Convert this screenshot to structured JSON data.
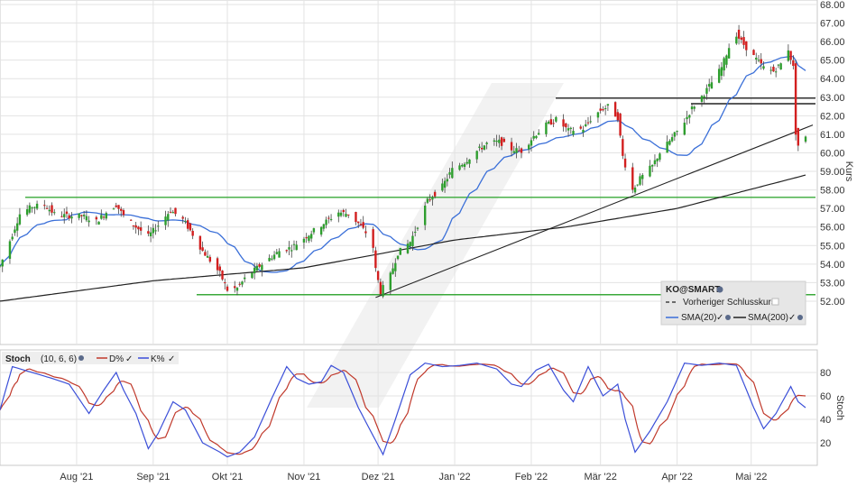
{
  "chart_data": [
    {
      "type": "candlestick",
      "symbol": "KO@SMART",
      "ylabel": "Kurs",
      "ylim": [
        51.0,
        68.0
      ],
      "y_ticks": [
        "68.00",
        "67.00",
        "66.00",
        "65.00",
        "64.00",
        "63.00",
        "62.00",
        "61.00",
        "60.00",
        "59.00",
        "58.00",
        "57.00",
        "56.00",
        "55.00",
        "54.00",
        "53.00",
        "52.00"
      ],
      "x_labels": [
        "Aug '21",
        "Sep '21",
        "Okt '21",
        "Nov '21",
        "Dez '21",
        "Jan '22",
        "Feb '22",
        "Mär '22",
        "Apr '22",
        "Mai '22"
      ],
      "legend": {
        "title": "KO@SMART",
        "items": [
          "Vorheriger Schlusskurs",
          "SMA(20)",
          "SMA(200)"
        ]
      },
      "colors": {
        "up": "#2e9e2e",
        "down": "#d21f1f",
        "sma20": "#3a6fd8",
        "sma200": "#222222",
        "support": "#3aa93a",
        "resistance": "#222222"
      },
      "horizontal_levels": [
        {
          "name": "green-support-57.6",
          "y": 57.6,
          "color": "#3aa93a"
        },
        {
          "name": "green-support-52.35",
          "y": 52.35,
          "color": "#3aa93a"
        },
        {
          "name": "resistance-62.95",
          "y": 62.95,
          "color": "#222222"
        },
        {
          "name": "resistance-62.65",
          "y": 62.65,
          "color": "#222222"
        }
      ],
      "trendline": {
        "from": [
          "2021-11-30",
          52.2
        ],
        "to": [
          "2022-05-23",
          61.5
        ]
      },
      "anchors": [
        [
          "2021-07-01",
          53.9
        ],
        [
          "2021-07-06",
          55.6
        ],
        [
          "2021-07-09",
          56.7
        ],
        [
          "2021-07-14",
          57.1
        ],
        [
          "2021-07-19",
          57.2
        ],
        [
          "2021-07-23",
          56.7
        ],
        [
          "2021-07-28",
          56.6
        ],
        [
          "2021-08-03",
          56.6
        ],
        [
          "2021-08-09",
          56.3
        ],
        [
          "2021-08-13",
          56.8
        ],
        [
          "2021-08-17",
          57.2
        ],
        [
          "2021-08-20",
          56.6
        ],
        [
          "2021-08-25",
          56.0
        ],
        [
          "2021-08-30",
          55.5
        ],
        [
          "2021-09-03",
          56.1
        ],
        [
          "2021-09-08",
          56.9
        ],
        [
          "2021-09-13",
          56.4
        ],
        [
          "2021-09-17",
          55.6
        ],
        [
          "2021-09-21",
          54.7
        ],
        [
          "2021-09-24",
          54.2
        ],
        [
          "2021-09-28",
          53.5
        ],
        [
          "2021-10-01",
          52.6
        ],
        [
          "2021-10-05",
          52.7
        ],
        [
          "2021-10-08",
          53.2
        ],
        [
          "2021-10-13",
          53.8
        ],
        [
          "2021-10-18",
          54.3
        ],
        [
          "2021-10-22",
          54.7
        ],
        [
          "2021-10-27",
          54.9
        ],
        [
          "2021-11-01",
          55.4
        ],
        [
          "2021-11-05",
          55.8
        ],
        [
          "2021-11-10",
          56.3
        ],
        [
          "2021-11-15",
          56.8
        ],
        [
          "2021-11-19",
          56.7
        ],
        [
          "2021-11-23",
          56.2
        ],
        [
          "2021-11-26",
          55.7
        ],
        [
          "2021-11-29",
          54.9
        ],
        [
          "2021-11-30",
          53.7
        ],
        [
          "2021-12-02",
          52.5
        ],
        [
          "2021-12-06",
          53.4
        ],
        [
          "2021-12-09",
          54.6
        ],
        [
          "2021-12-14",
          55.2
        ],
        [
          "2021-12-17",
          56.1
        ],
        [
          "2021-12-21",
          57.4
        ],
        [
          "2021-12-27",
          58.2
        ],
        [
          "2021-12-31",
          59.1
        ],
        [
          "2022-01-05",
          59.5
        ],
        [
          "2022-01-10",
          60.1
        ],
        [
          "2022-01-14",
          60.5
        ],
        [
          "2022-01-19",
          60.6
        ],
        [
          "2022-01-24",
          60.2
        ],
        [
          "2022-01-28",
          60.1
        ],
        [
          "2022-02-02",
          60.9
        ],
        [
          "2022-02-07",
          61.5
        ],
        [
          "2022-02-11",
          61.8
        ],
        [
          "2022-02-16",
          61.2
        ],
        [
          "2022-02-22",
          61.3
        ],
        [
          "2022-02-25",
          61.8
        ],
        [
          "2022-03-01",
          62.3
        ],
        [
          "2022-03-04",
          62.5
        ],
        [
          "2022-03-08",
          61.9
        ],
        [
          "2022-03-10",
          59.8
        ],
        [
          "2022-03-14",
          58.0
        ],
        [
          "2022-03-17",
          58.6
        ],
        [
          "2022-03-22",
          59.3
        ],
        [
          "2022-03-25",
          60.0
        ],
        [
          "2022-03-30",
          60.8
        ],
        [
          "2022-04-04",
          61.7
        ],
        [
          "2022-04-07",
          62.4
        ],
        [
          "2022-04-12",
          63.2
        ],
        [
          "2022-04-14",
          63.6
        ],
        [
          "2022-04-19",
          64.6
        ],
        [
          "2022-04-22",
          65.7
        ],
        [
          "2022-04-25",
          66.4
        ],
        [
          "2022-04-27",
          66.0
        ],
        [
          "2022-05-02",
          65.2
        ],
        [
          "2022-05-06",
          64.6
        ],
        [
          "2022-05-10",
          64.4
        ],
        [
          "2022-05-13",
          64.8
        ],
        [
          "2022-05-16",
          65.6
        ],
        [
          "2022-05-18",
          64.6
        ],
        [
          "2022-05-19",
          61.1
        ],
        [
          "2022-05-20",
          60.4
        ],
        [
          "2022-05-23",
          60.8
        ]
      ]
    },
    {
      "type": "line",
      "title": "Stoch",
      "params": "(10, 6, 6)",
      "series": [
        {
          "name": "D%",
          "color": "#c0392b"
        },
        {
          "name": "K%",
          "color": "#3b4fd8"
        }
      ],
      "ylabel": "Stoch",
      "ylim": [
        0,
        100
      ],
      "y_ticks": [
        "80",
        "60",
        "40",
        "20"
      ],
      "k_anchors": [
        [
          "2021-07-01",
          48
        ],
        [
          "2021-07-06",
          85
        ],
        [
          "2021-07-14",
          80
        ],
        [
          "2021-07-22",
          75
        ],
        [
          "2021-07-29",
          70
        ],
        [
          "2021-08-06",
          45
        ],
        [
          "2021-08-12",
          65
        ],
        [
          "2021-08-17",
          80
        ],
        [
          "2021-08-20",
          65
        ],
        [
          "2021-08-25",
          45
        ],
        [
          "2021-08-30",
          15
        ],
        [
          "2021-09-03",
          28
        ],
        [
          "2021-09-09",
          55
        ],
        [
          "2021-09-14",
          48
        ],
        [
          "2021-09-21",
          20
        ],
        [
          "2021-09-28",
          12
        ],
        [
          "2021-10-01",
          8
        ],
        [
          "2021-10-06",
          12
        ],
        [
          "2021-10-12",
          25
        ],
        [
          "2021-10-19",
          58
        ],
        [
          "2021-10-25",
          85
        ],
        [
          "2021-10-29",
          75
        ],
        [
          "2021-11-03",
          70
        ],
        [
          "2021-11-08",
          72
        ],
        [
          "2021-11-12",
          86
        ],
        [
          "2021-11-17",
          80
        ],
        [
          "2021-11-23",
          50
        ],
        [
          "2021-11-30",
          22
        ],
        [
          "2021-12-03",
          10
        ],
        [
          "2021-12-08",
          40
        ],
        [
          "2021-12-14",
          78
        ],
        [
          "2021-12-20",
          88
        ],
        [
          "2021-12-27",
          85
        ],
        [
          "2022-01-03",
          86
        ],
        [
          "2022-01-10",
          88
        ],
        [
          "2022-01-18",
          83
        ],
        [
          "2022-01-24",
          70
        ],
        [
          "2022-01-28",
          68
        ],
        [
          "2022-02-03",
          82
        ],
        [
          "2022-02-08",
          87
        ],
        [
          "2022-02-14",
          65
        ],
        [
          "2022-02-18",
          55
        ],
        [
          "2022-02-24",
          85
        ],
        [
          "2022-03-02",
          60
        ],
        [
          "2022-03-08",
          70
        ],
        [
          "2022-03-11",
          40
        ],
        [
          "2022-03-15",
          12
        ],
        [
          "2022-03-21",
          30
        ],
        [
          "2022-03-28",
          55
        ],
        [
          "2022-04-04",
          88
        ],
        [
          "2022-04-11",
          86
        ],
        [
          "2022-04-18",
          88
        ],
        [
          "2022-04-25",
          86
        ],
        [
          "2022-05-02",
          50
        ],
        [
          "2022-05-06",
          32
        ],
        [
          "2022-05-11",
          45
        ],
        [
          "2022-05-17",
          68
        ],
        [
          "2022-05-20",
          55
        ],
        [
          "2022-05-23",
          50
        ]
      ]
    }
  ]
}
